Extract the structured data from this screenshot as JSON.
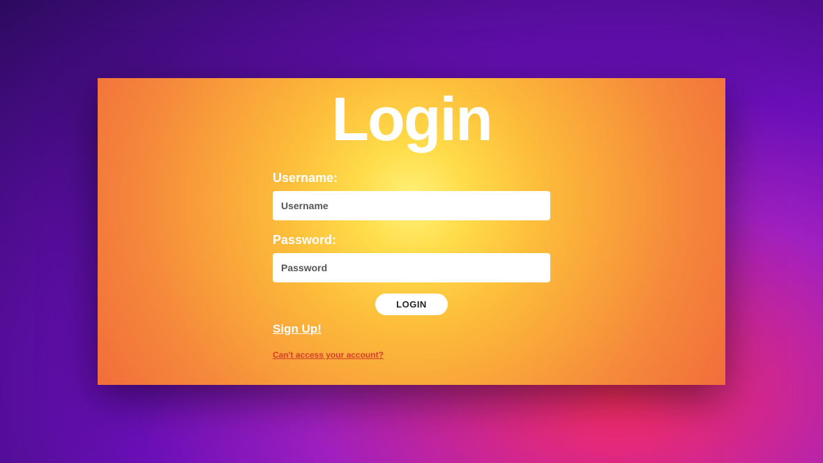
{
  "title": "Login",
  "form": {
    "username_label": "Username:",
    "username_placeholder": "Username",
    "password_label": "Password:",
    "password_placeholder": "Password",
    "submit_label": "LOGIN"
  },
  "links": {
    "signup": "Sign Up!",
    "forgot": "Can't access your account?"
  }
}
